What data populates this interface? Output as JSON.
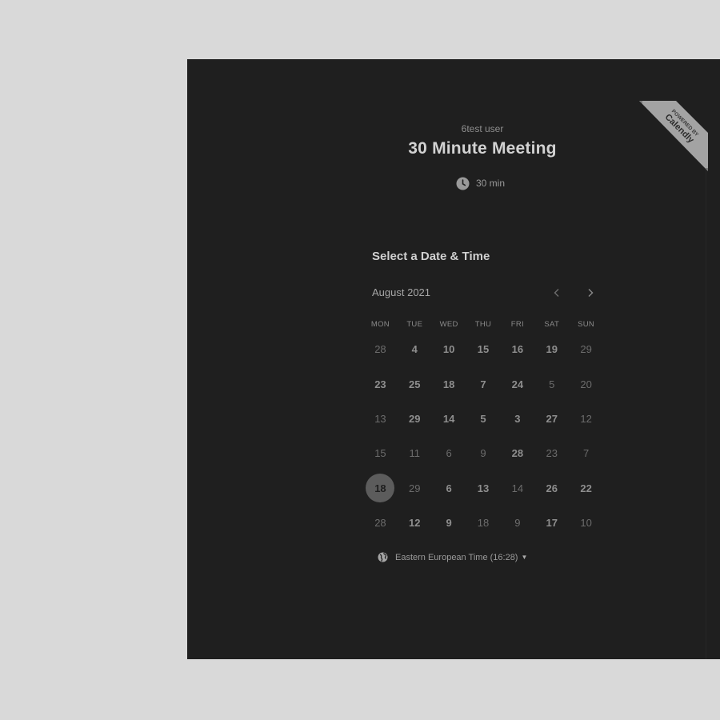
{
  "badge": {
    "line1": "POWERED BY",
    "line2": "Calendly"
  },
  "event": {
    "organizer": "6test user",
    "title": "30 Minute Meeting",
    "duration": "30 min"
  },
  "calendar": {
    "heading": "Select a Date & Time",
    "month": "August 2021",
    "weekdays": [
      "MON",
      "TUE",
      "WED",
      "THU",
      "FRI",
      "SAT",
      "SUN"
    ],
    "weeks": [
      [
        {
          "label": "28",
          "available": false
        },
        {
          "label": "4",
          "available": true
        },
        {
          "label": "10",
          "available": true
        },
        {
          "label": "15",
          "available": true
        },
        {
          "label": "16",
          "available": true
        },
        {
          "label": "19",
          "available": true
        },
        {
          "label": "29",
          "available": false
        }
      ],
      [
        {
          "label": "23",
          "available": true
        },
        {
          "label": "25",
          "available": true
        },
        {
          "label": "18",
          "available": true
        },
        {
          "label": "7",
          "available": true
        },
        {
          "label": "24",
          "available": true
        },
        {
          "label": "5",
          "available": false
        },
        {
          "label": "20",
          "available": false
        }
      ],
      [
        {
          "label": "13",
          "available": false
        },
        {
          "label": "29",
          "available": true
        },
        {
          "label": "14",
          "available": true
        },
        {
          "label": "5",
          "available": true
        },
        {
          "label": "3",
          "available": true
        },
        {
          "label": "27",
          "available": true
        },
        {
          "label": "12",
          "available": false
        }
      ],
      [
        {
          "label": "15",
          "available": false
        },
        {
          "label": "11",
          "available": false
        },
        {
          "label": "6",
          "available": false
        },
        {
          "label": "9",
          "available": false
        },
        {
          "label": "28",
          "available": true
        },
        {
          "label": "23",
          "available": false
        },
        {
          "label": "7",
          "available": false
        }
      ],
      [
        {
          "label": "18",
          "available": true,
          "selected": true
        },
        {
          "label": "29",
          "available": false
        },
        {
          "label": "6",
          "available": true
        },
        {
          "label": "13",
          "available": true
        },
        {
          "label": "14",
          "available": false
        },
        {
          "label": "26",
          "available": true
        },
        {
          "label": "22",
          "available": true
        }
      ],
      [
        {
          "label": "28",
          "available": false
        },
        {
          "label": "12",
          "available": true
        },
        {
          "label": "9",
          "available": true
        },
        {
          "label": "18",
          "available": false
        },
        {
          "label": "9",
          "available": false
        },
        {
          "label": "17",
          "available": true
        },
        {
          "label": "10",
          "available": false
        }
      ]
    ]
  },
  "timezone": {
    "label": "Eastern European Time (16:28)",
    "icon": "globe-icon"
  },
  "navigation": {
    "prev_icon": "chevron-left-icon",
    "next_icon": "chevron-right-icon"
  },
  "colors": {
    "page_background": "#d9d9d9",
    "panel_background": "#1f1f1f",
    "badge_background": "#a3a3a3",
    "selected_day": "#5c5c5c"
  }
}
